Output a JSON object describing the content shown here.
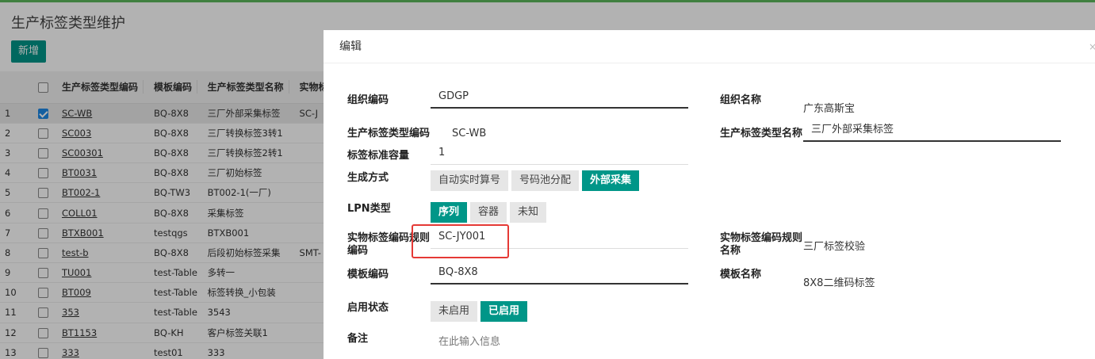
{
  "page": {
    "title": "生产标签类型维护",
    "add_label": "新增"
  },
  "table": {
    "headers": [
      "生产标签类型编码",
      "模板编码",
      "生产标签类型名称",
      "实物标"
    ],
    "rows": [
      {
        "idx": "1",
        "code": "SC-WB",
        "tpl": "BQ-8X8",
        "name": "三厂外部采集标签",
        "ext": "SC-J",
        "checked": true
      },
      {
        "idx": "2",
        "code": "SC003",
        "tpl": "BQ-8X8",
        "name": "三厂转换标签3转1",
        "ext": ""
      },
      {
        "idx": "3",
        "code": "SC00301",
        "tpl": "BQ-8X8",
        "name": "三厂转换标签2转1",
        "ext": ""
      },
      {
        "idx": "4",
        "code": "BT0031",
        "tpl": "BQ-8X8",
        "name": "三厂初始标签",
        "ext": ""
      },
      {
        "idx": "5",
        "code": "BT002-1",
        "tpl": "BQ-TW3",
        "name": "BT002-1(一厂)",
        "ext": ""
      },
      {
        "idx": "6",
        "code": "COLL01",
        "tpl": "BQ-8X8",
        "name": "采集标签",
        "ext": ""
      },
      {
        "idx": "7",
        "code": "BTXB001",
        "tpl": "testqgs",
        "name": "BTXB001",
        "ext": ""
      },
      {
        "idx": "8",
        "code": "test-b",
        "tpl": "BQ-8X8",
        "name": "后段初始标签采集",
        "ext": "SMT-"
      },
      {
        "idx": "9",
        "code": "TU001",
        "tpl": "test-Table",
        "name": "多转一",
        "ext": ""
      },
      {
        "idx": "10",
        "code": "BT009",
        "tpl": "test-Table",
        "name": "标签转换_小包装",
        "ext": ""
      },
      {
        "idx": "11",
        "code": "353",
        "tpl": "test-Table",
        "name": "3543",
        "ext": ""
      },
      {
        "idx": "12",
        "code": "BT1153",
        "tpl": "BQ-KH",
        "name": "客户标签关联1",
        "ext": ""
      },
      {
        "idx": "13",
        "code": "333",
        "tpl": "test01",
        "name": "333",
        "ext": ""
      }
    ]
  },
  "modal": {
    "title": "编辑",
    "close": "×",
    "org_code_label": "组织编码",
    "org_code": "GDGP",
    "org_name_label": "组织名称",
    "org_name": "广东高斯宝",
    "type_code_label": "生产标签类型编码",
    "type_code": "SC-WB",
    "type_name_label": "生产标签类型名称",
    "type_name": "三厂外部采集标签",
    "capacity_label": "标签标准容量",
    "capacity": "1",
    "gen_label": "生成方式",
    "gen_options": [
      "自动实时算号",
      "号码池分配",
      "外部采集"
    ],
    "lpn_label": "LPN类型",
    "lpn_options": [
      "序列",
      "容器",
      "未知"
    ],
    "rule_code_label_1": "实物标签编码规则",
    "rule_code_label_2": "编码",
    "rule_code": "SC-JY001",
    "rule_name_label_1": "实物标签编码规则",
    "rule_name_label_2": "名称",
    "rule_name": "三厂标签校验",
    "tpl_code_label": "模板编码",
    "tpl_code": "BQ-8X8",
    "tpl_name_label": "模板名称",
    "tpl_name": "8X8二维码标签",
    "status_label": "启用状态",
    "status_options": [
      "未启用",
      "已启用"
    ],
    "remark_label": "备注",
    "remark_placeholder": "在此输入信息"
  },
  "colors": {
    "accent": "#009688",
    "highlight": "#e53935",
    "topbar": "#5cb85c"
  }
}
